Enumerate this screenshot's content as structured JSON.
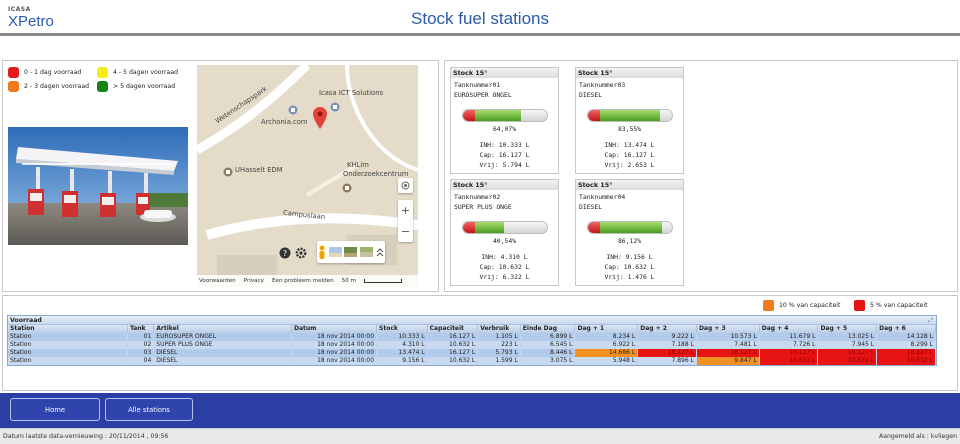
{
  "header": {
    "logo_top": "ICASA",
    "logo_main": "XPetro",
    "title": "Stock fuel stations"
  },
  "legend": [
    {
      "label": "0 - 1 dag voorraad",
      "color": "#e21b1b"
    },
    {
      "label": "2 - 3 dagen voorraad",
      "color": "#ee7a1d"
    },
    {
      "label": "4 - 5 dagen voorraad",
      "color": "#f2ee16"
    },
    {
      "label": "> 5 dagen voorraad",
      "color": "#128413"
    }
  ],
  "map": {
    "labels": {
      "wetenschapspark": "Wetenschapspark",
      "icasa": "Icasa ICT Solutions",
      "archonia": "Archonia.com",
      "uhasselt": "UHasselt EDM",
      "khlim1": "KHLim",
      "khlim2": "Onderzoekcentrum",
      "campuslaan": "Campuslaan"
    },
    "footer": {
      "voorwaarden": "Voorwaarden",
      "privacy": "Privacy",
      "probleem": "Een probleem melden",
      "scale": "50 m"
    }
  },
  "tanks": [
    {
      "head": "Stock 15°",
      "nr": "Tanknummer01",
      "product": "EUROSUPER ONGEL",
      "pct": "64,07%",
      "fill": 0.6407,
      "inh": "INH: 10.333 L",
      "cap": "Cap: 16.127 L",
      "vrij": "Vrij: 5.794 L"
    },
    {
      "head": "Stock 15°",
      "nr": "Tanknummer03",
      "product": "DIESEL",
      "pct": "83,55%",
      "fill": 0.8355,
      "inh": "INH: 13.474 L",
      "cap": "Cap: 16.127 L",
      "vrij": "Vrij: 2.653 L"
    },
    {
      "head": "Stock 15°",
      "nr": "Tanknummer02",
      "product": "SUPER PLUS ONGE",
      "pct": "40,54%",
      "fill": 0.4054,
      "inh": "INH: 4.310 L",
      "cap": "Cap: 10.632 L",
      "vrij": "Vrij: 6.322 L"
    },
    {
      "head": "Stock 15°",
      "nr": "Tanknummer04",
      "product": "DIESEL",
      "pct": "86,12%",
      "fill": 0.8612,
      "inh": "INH: 9.156 L",
      "cap": "Cap: 10.632 L",
      "vrij": "Vrij: 1.476 L"
    }
  ],
  "capacity_legend": [
    {
      "label": "10 %  van capaciteit",
      "color": "#f07d1b"
    },
    {
      "label": "5 %  van capaciteit",
      "color": "#e41414"
    }
  ],
  "grid": {
    "title": "Voorraad",
    "columns": [
      "Station",
      "Tank",
      "Artikel",
      "Datum",
      "Stock",
      "Capaciteit",
      "Verbruik",
      "Einde Dag",
      "Dag + 1",
      "Dag + 2",
      "Dag + 3",
      "Dag + 4",
      "Dag + 5",
      "Dag + 6"
    ],
    "rows": [
      {
        "cells": [
          "Station",
          "01",
          "EUROSUPER ONGEL",
          "18 nov 2014 00:00",
          "10.333 L",
          "16.127 L",
          "1.105 L",
          "6.899 L",
          "8.234 L",
          "9.222 L",
          "10.573 L",
          "11.679 L",
          "13.025 L",
          "14.128 L"
        ],
        "status": [
          "",
          "",
          "",
          "",
          "",
          "",
          "",
          "",
          "",
          "",
          "",
          "",
          "",
          ""
        ]
      },
      {
        "cells": [
          "Station",
          "02",
          "SUPER PLUS ONGE",
          "18 nov 2014 00:00",
          "4.310 L",
          "10.632 L",
          "223 L",
          "6.545 L",
          "6.922 L",
          "7.188 L",
          "7.481 L",
          "7.726 L",
          "7.945 L",
          "8.299 L"
        ],
        "status": [
          "",
          "",
          "",
          "",
          "",
          "",
          "",
          "",
          "",
          "",
          "",
          "",
          "",
          ""
        ]
      },
      {
        "cells": [
          "Station",
          "03",
          "DIESEL",
          "18 nov 2014 00:00",
          "13.474 L",
          "16.127 L",
          "5.793 L",
          "8.446 L",
          "14.686 L",
          "16.127 L",
          "16.127 L",
          "16.127 L",
          "16.127 L",
          "16.127 L"
        ],
        "status": [
          "",
          "",
          "",
          "",
          "",
          "",
          "",
          "",
          "orange",
          "red",
          "red",
          "red",
          "red",
          "red"
        ]
      },
      {
        "cells": [
          "Station",
          "04",
          "DIESEL",
          "18 nov 2014 00:00",
          "9.156 L",
          "10.632 L",
          "1.599 L",
          "3.075 L",
          "5.948 L",
          "7.896 L",
          "9.847 L",
          "10.632 L",
          "10.632 L",
          "10.632 L"
        ],
        "status": [
          "",
          "",
          "",
          "",
          "",
          "",
          "",
          "",
          "",
          "",
          "orange",
          "red",
          "red",
          "red"
        ]
      }
    ]
  },
  "nav": {
    "home": "Home",
    "all_stations": "Alle stations"
  },
  "status": {
    "left": "Datum laatste data-vernieuwing : 20/11/2014 , 09:56",
    "right": "Aangemeld als : kvliegen"
  }
}
